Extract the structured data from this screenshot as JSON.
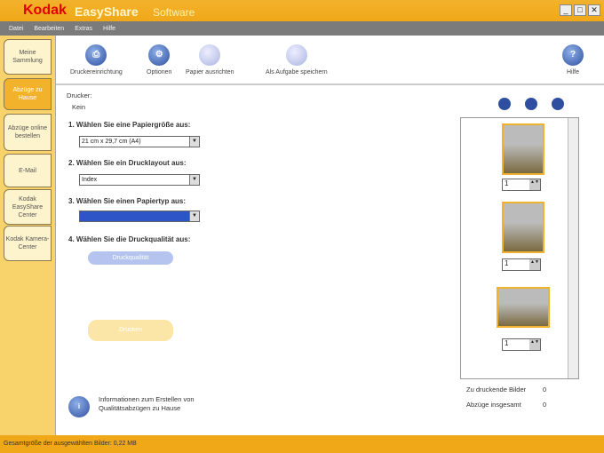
{
  "title": {
    "brand": "Kodak",
    "product": "EasyShare",
    "suffix": "Software"
  },
  "menu": [
    "Datei",
    "Bearbeiten",
    "Extras",
    "Hilfe"
  ],
  "tabs": [
    "Meine Sammlung",
    "Abzüge zu Hause",
    "Abzüge online bestellen",
    "E-Mail",
    "Kodak EasyShare Center",
    "Kodak Kamera-Center"
  ],
  "toolbar": {
    "items": [
      "Druckereinrichtung",
      "Optionen",
      "Papier ausrichten",
      "Als Aufgabe speichern"
    ],
    "help": "Hilfe"
  },
  "printer": {
    "label": "Drucker:",
    "value": "Kein"
  },
  "steps": [
    "1. Wählen Sie eine Papiergröße aus:",
    "2. Wählen Sie ein Drucklayout aus:",
    "3. Wählen Sie einen Papiertyp aus:",
    "4. Wählen Sie die Druckqualität aus:"
  ],
  "paper_size": "21 cm x 29,7 cm (A4)",
  "layout": "Index",
  "paper_type": "",
  "quality_button": "Druckqualität",
  "print_button": "Drucken",
  "info": "Informationen zum Erstellen von Qualitätsabzügen zu Hause",
  "thumbs": [
    {
      "qty": "1"
    },
    {
      "qty": "1"
    },
    {
      "qty": "1"
    }
  ],
  "summary": {
    "to_print_label": "Zu druckende Bilder",
    "to_print": "0",
    "total_label": "Abzüge insgesamt",
    "total": "0"
  },
  "status": "Gesamtgröße der ausgewählten Bilder: 0,22 MB"
}
